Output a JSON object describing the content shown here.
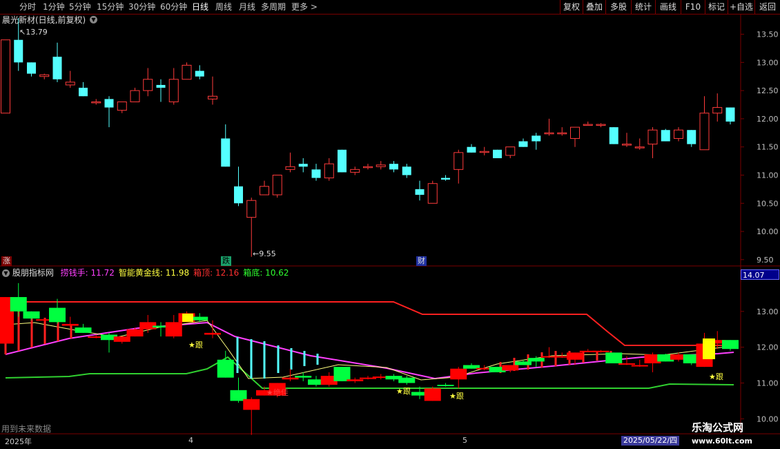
{
  "toolbar": {
    "left_items": [
      "分时",
      "1分钟",
      "5分钟",
      "15分钟",
      "30分钟",
      "60分钟",
      "日线",
      "周线",
      "月线",
      "多周期",
      "更多 >"
    ],
    "active_item": "日线",
    "right_items": [
      "复权",
      "叠加",
      "多股",
      "统计",
      "画线",
      "F10",
      "标记",
      "+自选",
      "返回"
    ]
  },
  "stock": {
    "title": "晨光新材(日线,前复权)",
    "high_marker": "13.79",
    "low_marker": "9.55"
  },
  "tags": {
    "zhang": "涨",
    "die": "跌",
    "cai": "财"
  },
  "indicator": {
    "name": "股朋指标网",
    "items": [
      {
        "label": "捞钱手: 11.72",
        "color": "#ff40ff"
      },
      {
        "label": "智能黄金线: 11.98",
        "color": "#ffff40"
      },
      {
        "label": "箱顶: 12.16",
        "color": "#ff3030"
      },
      {
        "label": "箱底: 10.62",
        "color": "#30ff30"
      }
    ],
    "current_value": "14.07",
    "markers": [
      "★跟",
      "★绝佳",
      "★跟",
      "★跟",
      "★跟"
    ]
  },
  "axes": {
    "price_ticks": [
      "13.50",
      "13.00",
      "12.50",
      "12.00",
      "11.50",
      "11.00",
      "10.50",
      "10.00",
      "9.50"
    ],
    "ind_ticks": [
      "14.00",
      "13.00",
      "12.00",
      "11.00",
      "10.00"
    ],
    "x_labels": [
      "2025年",
      "4",
      "5"
    ],
    "date_badge": "2025/05/22/四"
  },
  "footer": {
    "note": "用到未来数据",
    "watermark": "乐淘公式网",
    "watermark_url": "www.60lt.com"
  },
  "colors": {
    "up": "#ff3b3b",
    "down": "#54ffff",
    "ind_up": "#ff0000",
    "ind_down": "#00ff40",
    "box_top": "#ff2020",
    "box_bottom": "#30d030",
    "line_magenta": "#ff40ff",
    "line_yellow": "#ffff80",
    "grid": "#7a0000"
  },
  "chart_data": {
    "type": "candlestick",
    "ylim": [
      9.4,
      13.85
    ],
    "candles": [
      {
        "o": 12.1,
        "h": 13.4,
        "l": 12.1,
        "c": 13.4
      },
      {
        "o": 13.4,
        "h": 13.79,
        "l": 12.85,
        "c": 13.0
      },
      {
        "o": 13.0,
        "h": 13.0,
        "l": 12.75,
        "c": 12.8
      },
      {
        "o": 12.75,
        "h": 12.8,
        "l": 12.7,
        "c": 12.78
      },
      {
        "o": 13.1,
        "h": 13.35,
        "l": 12.65,
        "c": 12.7
      },
      {
        "o": 12.6,
        "h": 12.85,
        "l": 12.55,
        "c": 12.65
      },
      {
        "o": 12.55,
        "h": 12.65,
        "l": 12.4,
        "c": 12.4
      },
      {
        "o": 12.3,
        "h": 12.35,
        "l": 12.25,
        "c": 12.3
      },
      {
        "o": 12.35,
        "h": 12.4,
        "l": 11.85,
        "c": 12.2
      },
      {
        "o": 12.15,
        "h": 12.3,
        "l": 12.1,
        "c": 12.3
      },
      {
        "o": 12.3,
        "h": 12.55,
        "l": 12.3,
        "c": 12.5
      },
      {
        "o": 12.5,
        "h": 12.9,
        "l": 12.4,
        "c": 12.7
      },
      {
        "o": 12.6,
        "h": 12.7,
        "l": 12.3,
        "c": 12.55
      },
      {
        "o": 12.3,
        "h": 12.9,
        "l": 12.25,
        "c": 12.7
      },
      {
        "o": 12.7,
        "h": 13.0,
        "l": 12.7,
        "c": 12.95
      },
      {
        "o": 12.85,
        "h": 12.95,
        "l": 12.7,
        "c": 12.75
      },
      {
        "o": 12.35,
        "h": 12.75,
        "l": 12.25,
        "c": 12.4
      },
      {
        "o": 11.65,
        "h": 11.9,
        "l": 11.15,
        "c": 11.15
      },
      {
        "o": 10.8,
        "h": 11.15,
        "l": 10.45,
        "c": 10.5
      },
      {
        "o": 10.25,
        "h": 10.6,
        "l": 9.55,
        "c": 10.55
      },
      {
        "o": 10.65,
        "h": 10.9,
        "l": 10.65,
        "c": 10.8
      },
      {
        "o": 10.65,
        "h": 11.0,
        "l": 10.6,
        "c": 11.0
      },
      {
        "o": 11.1,
        "h": 11.4,
        "l": 11.05,
        "c": 11.15
      },
      {
        "o": 11.2,
        "h": 11.3,
        "l": 11.05,
        "c": 11.15
      },
      {
        "o": 11.1,
        "h": 11.2,
        "l": 10.9,
        "c": 10.95
      },
      {
        "o": 10.95,
        "h": 11.3,
        "l": 10.9,
        "c": 11.2
      },
      {
        "o": 11.45,
        "h": 11.45,
        "l": 11.05,
        "c": 11.05
      },
      {
        "o": 11.05,
        "h": 11.15,
        "l": 11.0,
        "c": 11.1
      },
      {
        "o": 11.15,
        "h": 11.2,
        "l": 11.1,
        "c": 11.15
      },
      {
        "o": 11.15,
        "h": 11.25,
        "l": 11.1,
        "c": 11.18
      },
      {
        "o": 11.2,
        "h": 11.25,
        "l": 11.05,
        "c": 11.1
      },
      {
        "o": 11.15,
        "h": 11.2,
        "l": 10.95,
        "c": 11.0
      },
      {
        "o": 10.75,
        "h": 10.9,
        "l": 10.55,
        "c": 10.65
      },
      {
        "o": 10.5,
        "h": 10.9,
        "l": 10.5,
        "c": 10.85
      },
      {
        "o": 10.95,
        "h": 11.0,
        "l": 10.9,
        "c": 10.92
      },
      {
        "o": 11.1,
        "h": 11.45,
        "l": 10.85,
        "c": 11.4
      },
      {
        "o": 11.5,
        "h": 11.55,
        "l": 11.4,
        "c": 11.4
      },
      {
        "o": 11.42,
        "h": 11.5,
        "l": 11.35,
        "c": 11.42
      },
      {
        "o": 11.45,
        "h": 11.45,
        "l": 11.3,
        "c": 11.3
      },
      {
        "o": 11.35,
        "h": 11.5,
        "l": 11.3,
        "c": 11.5
      },
      {
        "o": 11.6,
        "h": 11.65,
        "l": 11.5,
        "c": 11.5
      },
      {
        "o": 11.7,
        "h": 11.75,
        "l": 11.45,
        "c": 11.6
      },
      {
        "o": 11.75,
        "h": 12.0,
        "l": 11.7,
        "c": 11.75
      },
      {
        "o": 11.75,
        "h": 11.85,
        "l": 11.7,
        "c": 11.75
      },
      {
        "o": 11.65,
        "h": 11.85,
        "l": 11.5,
        "c": 11.85
      },
      {
        "o": 11.9,
        "h": 11.95,
        "l": 11.9,
        "c": 11.9
      },
      {
        "o": 11.9,
        "h": 11.92,
        "l": 11.85,
        "c": 11.9
      },
      {
        "o": 11.85,
        "h": 11.85,
        "l": 11.55,
        "c": 11.55
      },
      {
        "o": 11.55,
        "h": 11.75,
        "l": 11.5,
        "c": 11.55
      },
      {
        "o": 11.5,
        "h": 11.65,
        "l": 11.45,
        "c": 11.5
      },
      {
        "o": 11.55,
        "h": 11.85,
        "l": 11.3,
        "c": 11.8
      },
      {
        "o": 11.8,
        "h": 11.82,
        "l": 11.6,
        "c": 11.6
      },
      {
        "o": 11.65,
        "h": 11.85,
        "l": 11.6,
        "c": 11.8
      },
      {
        "o": 11.8,
        "h": 11.8,
        "l": 11.5,
        "c": 11.55
      },
      {
        "o": 11.45,
        "h": 12.4,
        "l": 11.45,
        "c": 12.1
      },
      {
        "o": 12.1,
        "h": 12.45,
        "l": 11.95,
        "c": 12.2
      },
      {
        "o": 12.2,
        "h": 12.2,
        "l": 11.9,
        "c": 11.95
      }
    ],
    "box_top": [
      12.16
    ],
    "box_bottom": [
      10.62
    ]
  }
}
